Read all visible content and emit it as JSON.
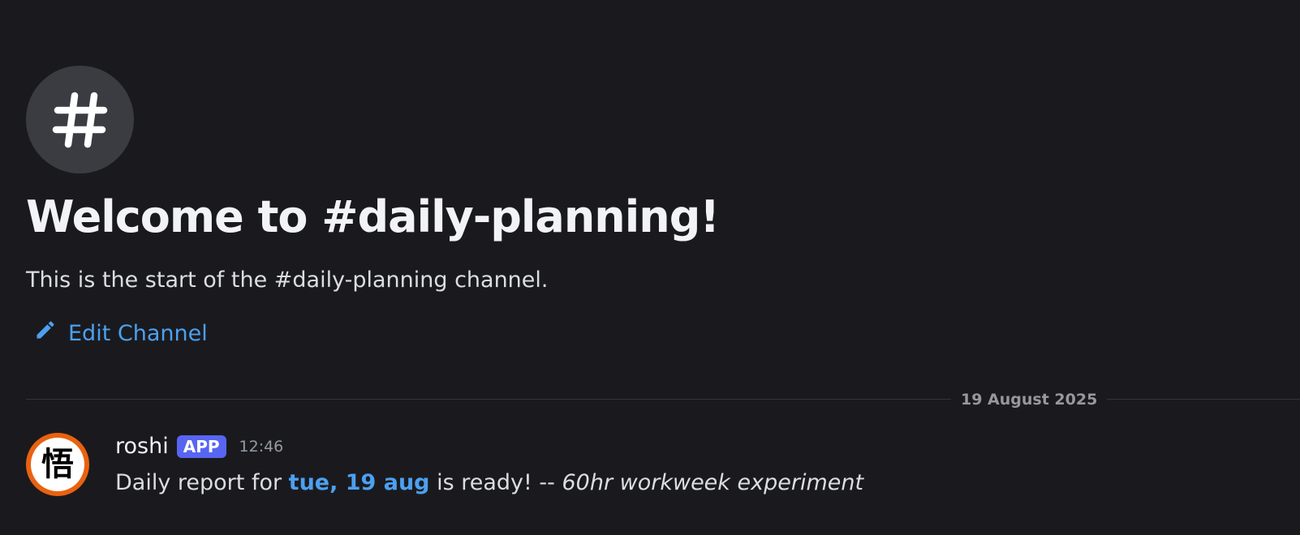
{
  "channel": {
    "icon": "hashtag-icon",
    "welcome_title": "Welcome to #daily-planning!",
    "welcome_subtitle": "This is the start of the #daily-planning channel.",
    "edit_label": "Edit Channel",
    "edit_icon": "pencil-icon"
  },
  "divider": {
    "date": "19 August 2025"
  },
  "message": {
    "author": "roshi",
    "badge": "APP",
    "time": "12:46",
    "avatar_glyph": "悟",
    "text_prefix": "Daily report for ",
    "date_link": "tue, 19 aug",
    "text_middle": " is ready!  -- ",
    "text_italic": " 60hr workweek experiment"
  },
  "colors": {
    "background": "#1a1a1e",
    "link": "#4ca0f0",
    "badge": "#5865f2",
    "avatar_ring": "#e9620f"
  }
}
